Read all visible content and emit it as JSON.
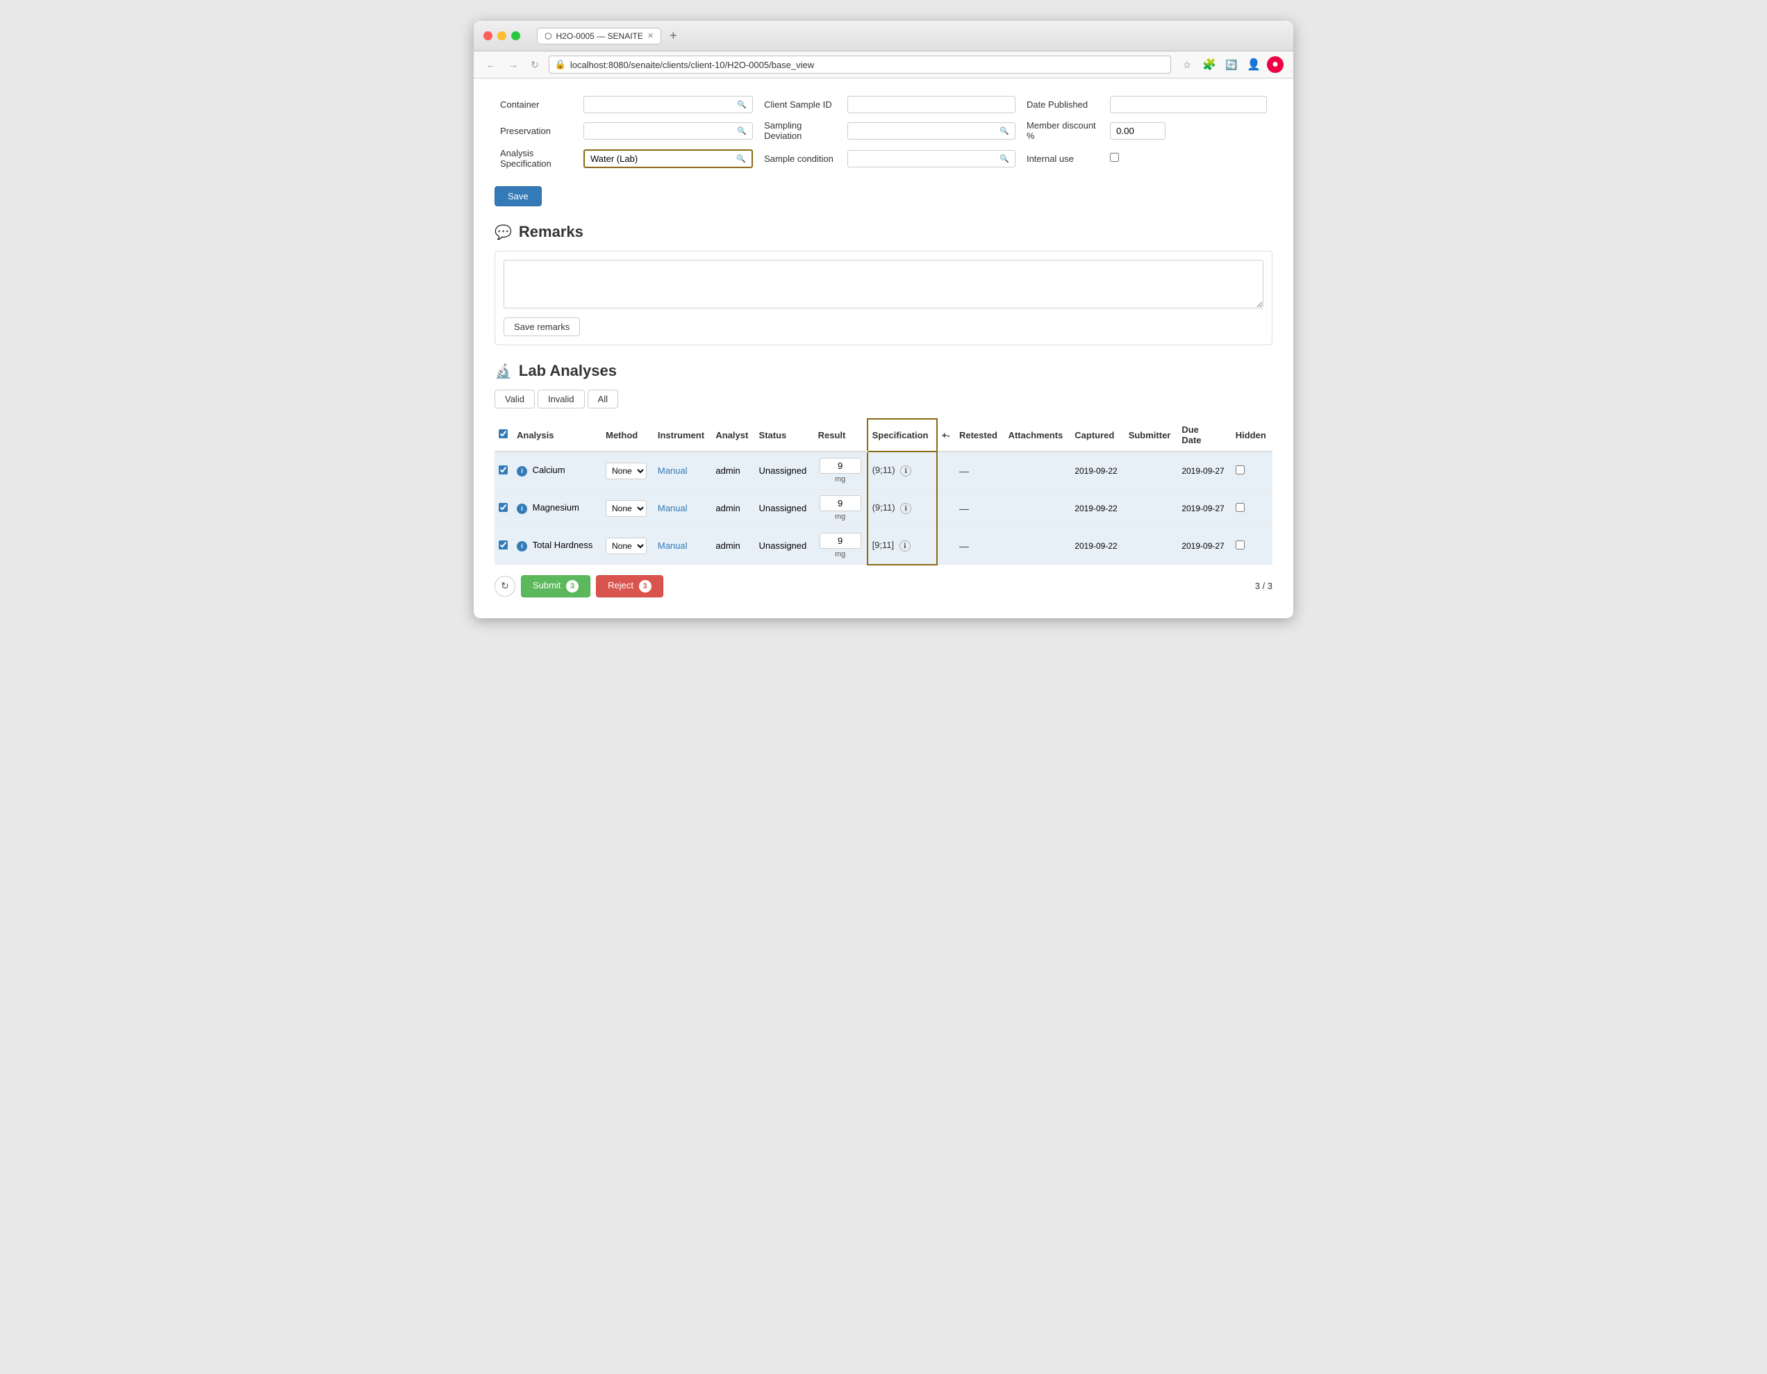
{
  "browser": {
    "tab_title": "H2O-0005 — SENAITE",
    "tab_icon": "senaite-icon",
    "url": "localhost:8080/senaite/clients/client-10/H2O-0005/base_view",
    "new_tab_label": "+"
  },
  "form": {
    "container_label": "Container",
    "preservation_label": "Preservation",
    "analysis_spec_label": "Analysis Specification",
    "analysis_spec_value": "Water (Lab)",
    "client_sample_id_label": "Client Sample ID",
    "date_published_label": "Date Published",
    "sampling_deviation_label": "Sampling Deviation",
    "member_discount_label": "Member discount %",
    "member_discount_value": "0.00",
    "sample_condition_label": "Sample condition",
    "internal_use_label": "Internal use",
    "save_label": "Save"
  },
  "remarks": {
    "title": "Remarks",
    "placeholder": "",
    "save_remarks_label": "Save remarks"
  },
  "lab_analyses": {
    "title": "Lab Analyses",
    "filter_valid": "Valid",
    "filter_invalid": "Invalid",
    "filter_all": "All",
    "columns": {
      "analysis": "Analysis",
      "method": "Method",
      "instrument": "Instrument",
      "analyst": "Analyst",
      "status": "Status",
      "result": "Result",
      "specification": "Specification",
      "plusminus": "+-",
      "retested": "Retested",
      "attachments": "Attachments",
      "captured": "Captured",
      "submitter": "Submitter",
      "due_date": "Due Date",
      "hidden": "Hidden"
    },
    "rows": [
      {
        "checked": true,
        "name": "Calcium",
        "method": "None",
        "instrument": "Manual",
        "analyst": "admin",
        "status": "Unassigned",
        "result": "9",
        "unit": "mg",
        "specification": "(9;11)",
        "retested": "—",
        "attachments": "",
        "captured": "2019-09-22",
        "submitter": "",
        "due_date": "2019-09-27",
        "hidden": false
      },
      {
        "checked": true,
        "name": "Magnesium",
        "method": "None",
        "instrument": "Manual",
        "analyst": "admin",
        "status": "Unassigned",
        "result": "9",
        "unit": "mg",
        "specification": "(9;11)",
        "retested": "—",
        "attachments": "",
        "captured": "2019-09-22",
        "submitter": "",
        "due_date": "2019-09-27",
        "hidden": false
      },
      {
        "checked": true,
        "name": "Total Hardness",
        "method": "None",
        "instrument": "Manual",
        "analyst": "admin",
        "status": "Unassigned",
        "result": "9",
        "unit": "mg",
        "specification": "[9;11]",
        "retested": "—",
        "attachments": "",
        "captured": "2019-09-22",
        "submitter": "",
        "due_date": "2019-09-27",
        "hidden": false
      }
    ],
    "submit_label": "Submit",
    "submit_count": "3",
    "reject_label": "Reject",
    "reject_count": "3",
    "pagination": "3 / 3"
  },
  "colors": {
    "accent_blue": "#337ab7",
    "spec_border": "#8b6914",
    "row_bg": "#e8f0f7",
    "submit_green": "#5cb85c",
    "reject_red": "#d9534f"
  }
}
